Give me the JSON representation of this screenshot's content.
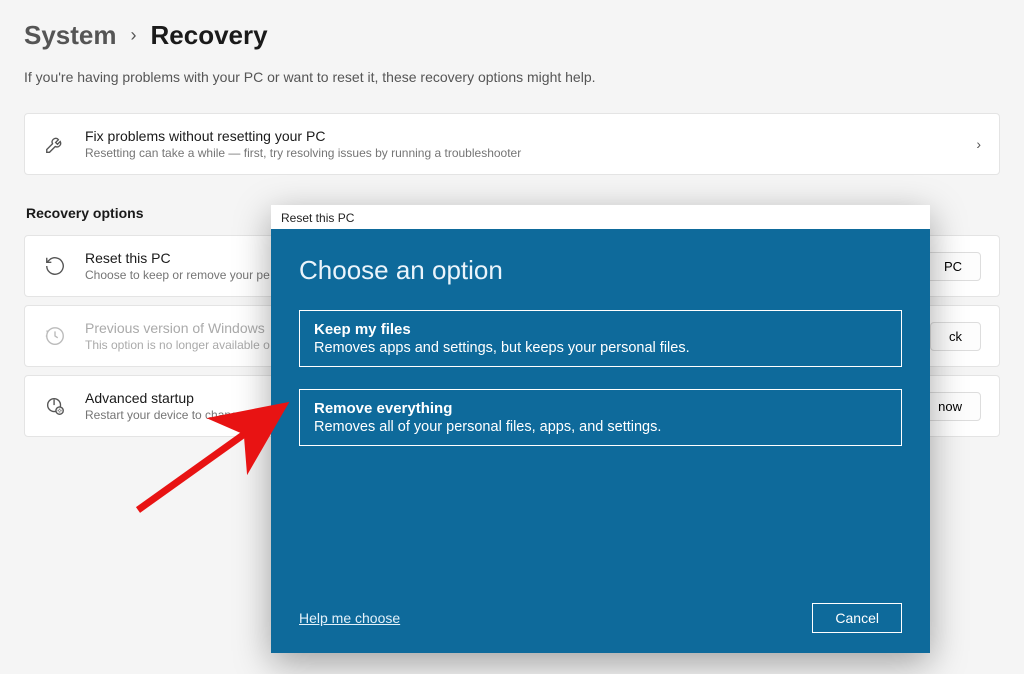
{
  "breadcrumb": {
    "parent": "System",
    "current": "Recovery"
  },
  "subtitle": "If you're having problems with your PC or want to reset it, these recovery options might help.",
  "fix_card": {
    "title": "Fix problems without resetting your PC",
    "desc": "Resetting can take a while — first, try resolving issues by running a troubleshooter"
  },
  "section_title": "Recovery options",
  "options": [
    {
      "title": "Reset this PC",
      "desc": "Choose to keep or remove your pe",
      "button": "PC"
    },
    {
      "title": "Previous version of Windows",
      "desc": "This option is no longer available o",
      "button": "ck"
    },
    {
      "title": "Advanced startup",
      "desc": "Restart your device to chang",
      "button": "now"
    }
  ],
  "dialog": {
    "titlebar": "Reset this PC",
    "heading": "Choose an option",
    "choices": [
      {
        "title": "Keep my files",
        "desc": "Removes apps and settings, but keeps your personal files."
      },
      {
        "title": "Remove everything",
        "desc": "Removes all of your personal files, apps, and settings."
      }
    ],
    "help": "Help me choose",
    "cancel": "Cancel"
  },
  "colors": {
    "dialog_bg": "#0e6a9b",
    "arrow": "#e81313"
  }
}
